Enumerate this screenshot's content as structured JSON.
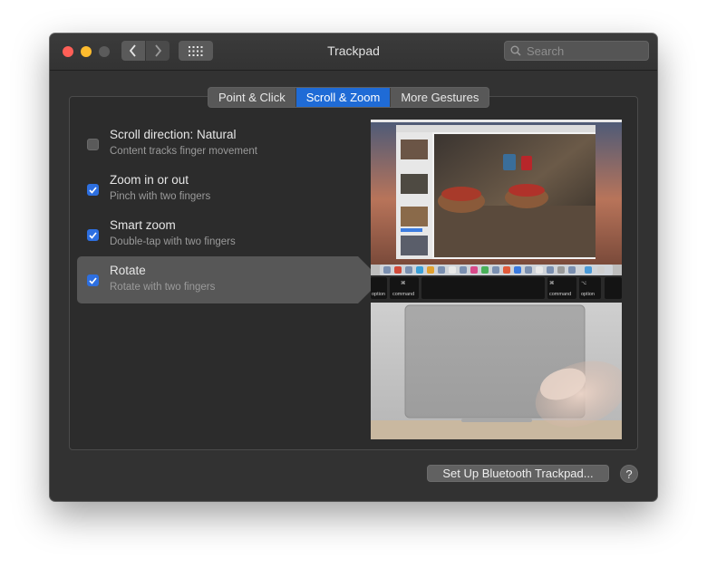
{
  "window": {
    "title": "Trackpad"
  },
  "search": {
    "placeholder": "Search"
  },
  "tabs": [
    {
      "label": "Point & Click",
      "active": false
    },
    {
      "label": "Scroll & Zoom",
      "active": true
    },
    {
      "label": "More Gestures",
      "active": false
    }
  ],
  "options": [
    {
      "title": "Scroll direction: Natural",
      "subtitle": "Content tracks finger movement",
      "checked": false,
      "selected": false
    },
    {
      "title": "Zoom in or out",
      "subtitle": "Pinch with two fingers",
      "checked": true,
      "selected": false
    },
    {
      "title": "Smart zoom",
      "subtitle": "Double-tap with two fingers",
      "checked": true,
      "selected": false
    },
    {
      "title": "Rotate",
      "subtitle": "Rotate with two fingers",
      "checked": true,
      "selected": true
    }
  ],
  "preview": {
    "keys": {
      "option": "option",
      "command": "command",
      "command_symbol": "⌘",
      "option_symbol": "⌥"
    }
  },
  "footer": {
    "setup_button": "Set Up Bluetooth Trackpad...",
    "help": "?"
  },
  "colors": {
    "accent": "#1f6bd6",
    "window_bg": "#323232",
    "selected_row": "#575757"
  }
}
